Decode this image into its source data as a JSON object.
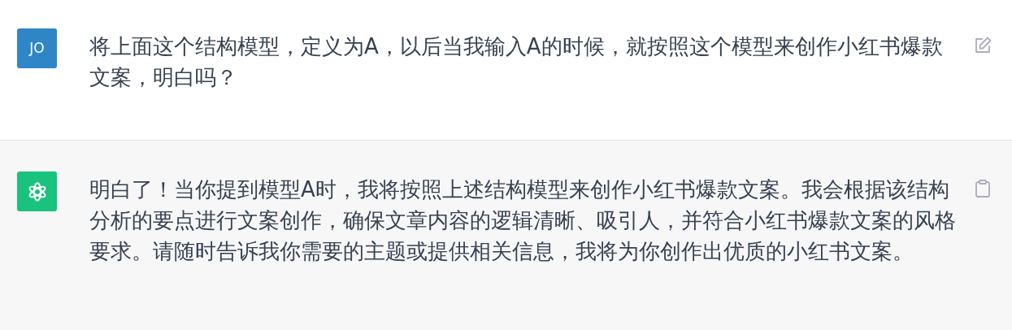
{
  "messages": [
    {
      "kind": "user",
      "avatar": "JO",
      "text": "将上面这个结构模型，定义为A，以后当我输入A的时候，就按照这个模型来创作小红书爆款文案，明白吗？"
    },
    {
      "kind": "assistant",
      "text": "明白了！当你提到模型A时，我将按照上述结构模型来创作小红书爆款文案。我会根据该结构分析的要点进行文案创作，确保文章内容的逻辑清晰、吸引人，并符合小红书爆款文案的风格要求。请随时告诉我你需要的主题或提供相关信息，我将为你创作出优质的小红书文案。"
    }
  ]
}
